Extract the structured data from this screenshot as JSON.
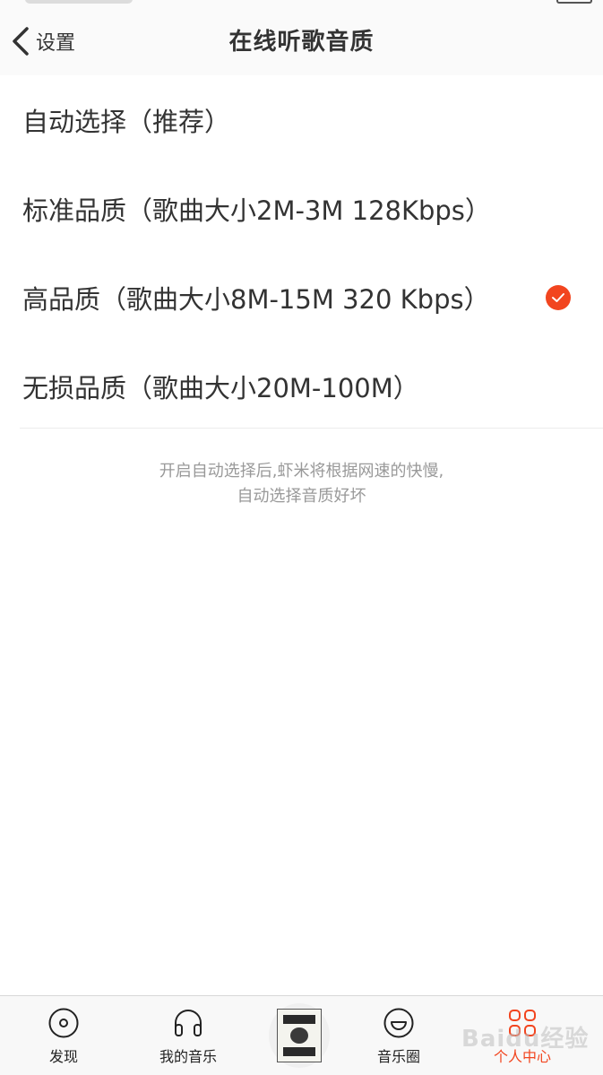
{
  "nav": {
    "back_label": "设置",
    "title": "在线听歌音质"
  },
  "options": [
    {
      "label": "自动选择（推荐）",
      "selected": false
    },
    {
      "label": "标准品质（歌曲大小2M-3M 128Kbps）",
      "selected": false
    },
    {
      "label": "高品质（歌曲大小8M-15M 320 Kbps）",
      "selected": true
    },
    {
      "label": "无损品质（歌曲大小20M-100M）",
      "selected": false
    }
  ],
  "hint": {
    "line1": "开启自动选择后,虾米将根据网速的快慢,",
    "line2": "自动选择音质好坏"
  },
  "tabbar": {
    "discover": "发现",
    "my_music": "我的音乐",
    "music_circle": "音乐圈",
    "me": "个人中心"
  },
  "watermark": "Baidu经验",
  "colors": {
    "accent": "#f2451f",
    "text": "#333333",
    "hint": "#999999"
  },
  "icons": {
    "back": "chevron-left-icon",
    "check": "check-circle-icon",
    "discover": "disc-icon",
    "my_music": "headphones-icon",
    "music_circle": "smiley-icon",
    "me": "grid-icon"
  }
}
